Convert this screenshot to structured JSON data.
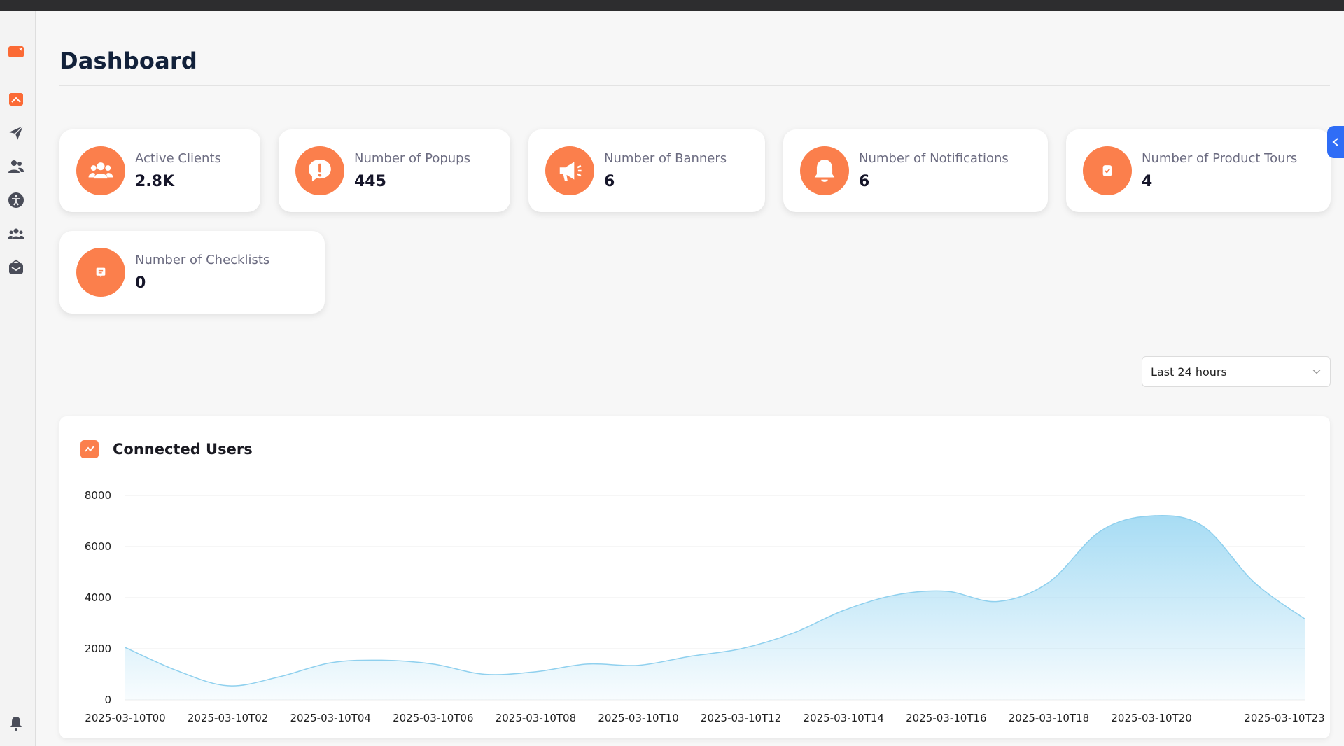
{
  "page": {
    "title": "Dashboard"
  },
  "sidebar": {
    "items": [
      {
        "icon": "app-logo-icon"
      },
      {
        "icon": "home-icon"
      },
      {
        "icon": "send-icon"
      },
      {
        "icon": "users-icon"
      },
      {
        "icon": "accessibility-icon"
      },
      {
        "icon": "group-icon"
      },
      {
        "icon": "mailbox-icon"
      },
      {
        "icon": "bell-icon"
      }
    ]
  },
  "stats": [
    {
      "label": "Active Clients",
      "value": "2.8K",
      "icon": "users-icon"
    },
    {
      "label": "Number of Popups",
      "value": "445",
      "icon": "alert-icon"
    },
    {
      "label": "Number of Banners",
      "value": "6",
      "icon": "megaphone-icon"
    },
    {
      "label": "Number of Notifications",
      "value": "6",
      "icon": "bell-icon"
    },
    {
      "label": "Number of Product Tours",
      "value": "4",
      "icon": "tour-icon"
    },
    {
      "label": "Number of Checklists",
      "value": "0",
      "icon": "checklist-icon"
    }
  ],
  "range_select": {
    "selected": "Last 24 hours"
  },
  "colors": {
    "accent": "#fb7f4c",
    "area_fill": "#a7dcf4",
    "line": "#8fd0ee",
    "edge_tab": "#2f6df6"
  },
  "chart_card": {
    "title": "Connected Users",
    "icon": "trend-icon"
  },
  "chart_data": {
    "type": "area",
    "title": "Connected Users",
    "xlabel": "",
    "ylabel": "",
    "ylim": [
      0,
      8000
    ],
    "yticks": [
      0,
      2000,
      4000,
      6000,
      8000
    ],
    "x_tick_labels": [
      "2025-03-10T00",
      "2025-03-10T02",
      "2025-03-10T04",
      "2025-03-10T06",
      "2025-03-10T08",
      "2025-03-10T10",
      "2025-03-10T12",
      "2025-03-10T14",
      "2025-03-10T16",
      "2025-03-10T18",
      "2025-03-10T20",
      "2025-03-10T23"
    ],
    "x": [
      "2025-03-10T00",
      "2025-03-10T01",
      "2025-03-10T02",
      "2025-03-10T03",
      "2025-03-10T04",
      "2025-03-10T05",
      "2025-03-10T06",
      "2025-03-10T07",
      "2025-03-10T08",
      "2025-03-10T09",
      "2025-03-10T10",
      "2025-03-10T11",
      "2025-03-10T12",
      "2025-03-10T13",
      "2025-03-10T14",
      "2025-03-10T15",
      "2025-03-10T16",
      "2025-03-10T17",
      "2025-03-10T18",
      "2025-03-10T19",
      "2025-03-10T20",
      "2025-03-10T21",
      "2025-03-10T22",
      "2025-03-10T23"
    ],
    "series": [
      {
        "values": [
          2050,
          1150,
          550,
          900,
          1450,
          1550,
          1400,
          1000,
          1100,
          1400,
          1350,
          1700,
          2000,
          2600,
          3500,
          4100,
          4250,
          3850,
          4600,
          6600,
          7200,
          6800,
          4600,
          3150
        ]
      }
    ],
    "grid": true,
    "legend": "none"
  }
}
